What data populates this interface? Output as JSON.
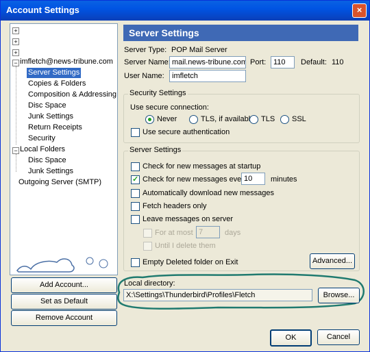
{
  "window": {
    "title": "Account Settings",
    "close": "×"
  },
  "tree": {
    "collapsed_items": [
      "+",
      "+",
      "+"
    ],
    "account": "imfletch@news-tribune.com",
    "account_children": [
      "Server Settings",
      "Copies & Folders",
      "Composition & Addressing",
      "Disc Space",
      "Junk Settings",
      "Return Receipts",
      "Security"
    ],
    "local_folders": "Local Folders",
    "local_children": [
      "Disc Space",
      "Junk Settings"
    ],
    "outgoing": "Outgoing Server (SMTP)"
  },
  "left_buttons": {
    "add": "Add Account...",
    "default": "Set as Default",
    "remove": "Remove Account"
  },
  "main": {
    "header": "Server Settings",
    "server_type_label": "Server Type:",
    "server_type_value": "POP Mail Server",
    "server_name_label": "Server Name:",
    "server_name_value": "mail.news-tribune.com",
    "port_label": "Port:",
    "port_value": "110",
    "default_label": "Default:",
    "default_value": "110",
    "user_name_label": "User Name:",
    "user_name_value": "imfletch"
  },
  "security": {
    "legend": "Security Settings",
    "use_secure_label": "Use secure connection:",
    "radios": [
      "Never",
      "TLS, if available",
      "TLS",
      "SSL"
    ],
    "selected": "Never",
    "secure_auth": "Use secure authentication"
  },
  "server_settings": {
    "legend": "Server Settings",
    "check_startup": "Check for new messages at startup",
    "check_every": "Check for new messages every",
    "check_every_value": "10",
    "minutes": "minutes",
    "auto_download": "Automatically download new messages",
    "fetch_headers": "Fetch headers only",
    "leave_messages": "Leave messages on server",
    "for_at_most": "For at most",
    "days_value": "7",
    "days": "days",
    "until_delete": "Until I delete them",
    "empty_deleted": "Empty Deleted folder on Exit",
    "advanced": "Advanced..."
  },
  "local_dir": {
    "label": "Local directory:",
    "value": "X:\\Settings\\Thunderbird\\Profiles\\Fletch",
    "browse": "Browse..."
  },
  "footer": {
    "ok": "OK",
    "cancel": "Cancel"
  }
}
